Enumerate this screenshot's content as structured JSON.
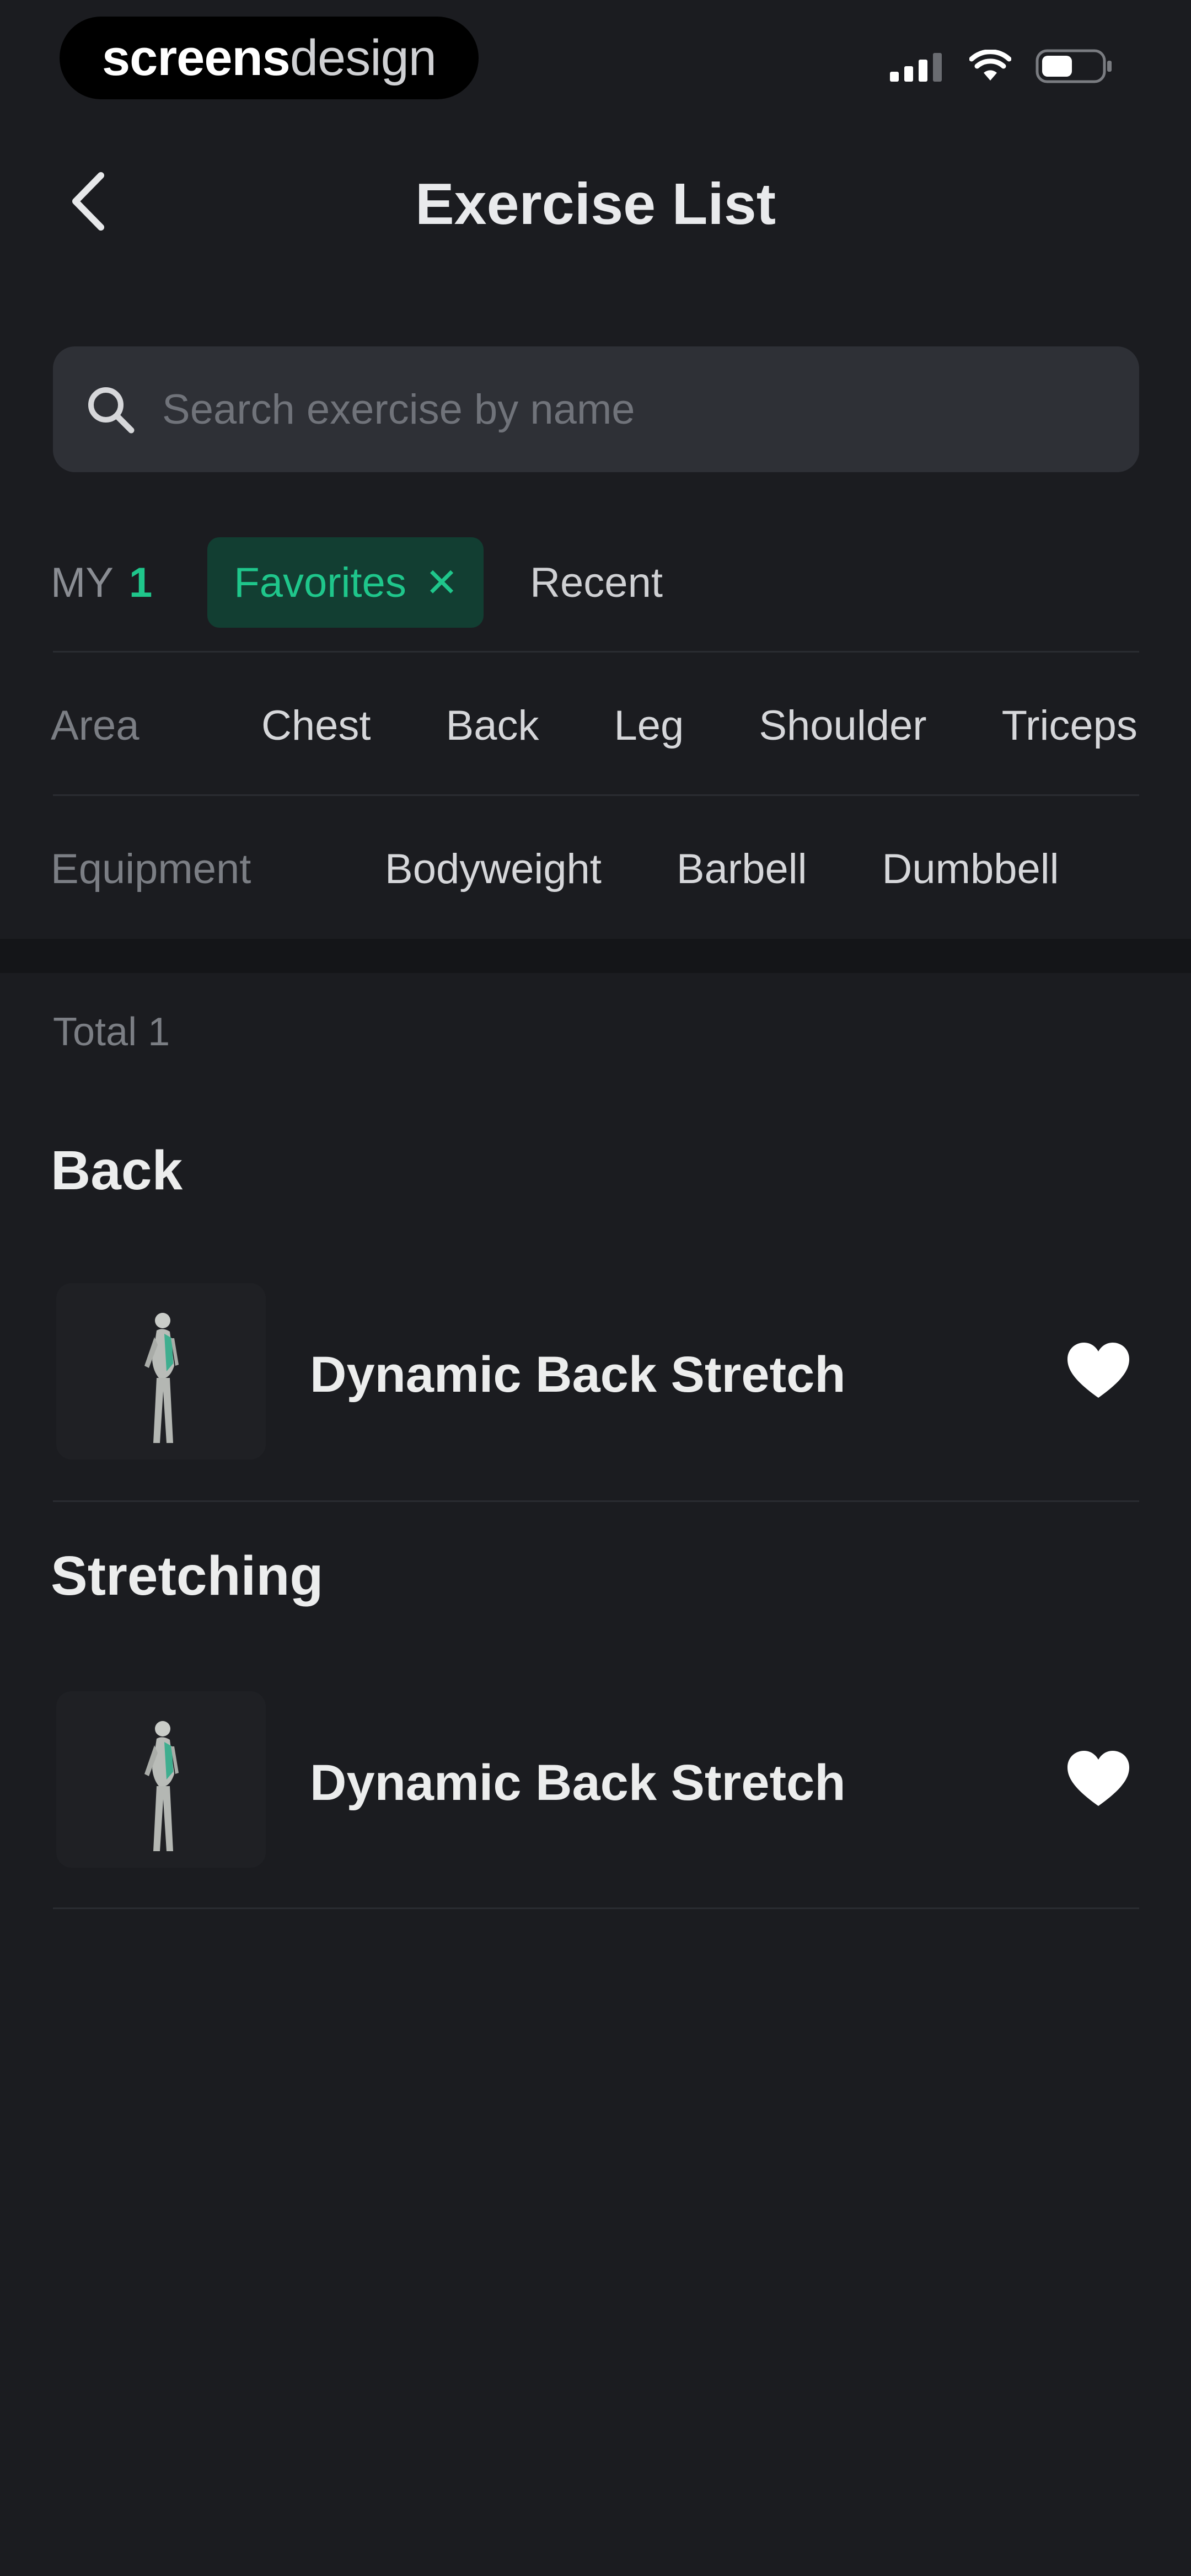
{
  "status_bar": {
    "brand_strong": "screens",
    "brand_light": "design",
    "icons": [
      "signal-icon",
      "wifi-icon",
      "battery-icon"
    ]
  },
  "nav": {
    "title": "Exercise List",
    "back_icon": "chevron-left-icon"
  },
  "search": {
    "placeholder": "Search exercise by name",
    "value": "",
    "icon": "search-icon"
  },
  "filters": {
    "my_label": "MY",
    "my_count": "1",
    "favorites_label": "Favorites",
    "favorites_close": "✕",
    "recent_label": "Recent",
    "area_label": "Area",
    "area_options": [
      "Chest",
      "Back",
      "Leg",
      "Shoulder",
      "Triceps"
    ],
    "equipment_label": "Equipment",
    "equipment_options": [
      "Bodyweight",
      "Barbell",
      "Dumbbell"
    ]
  },
  "list": {
    "total_label": "Total 1",
    "groups": [
      {
        "title": "Back",
        "items": [
          {
            "name": "Dynamic Back Stretch",
            "favorite": true
          }
        ]
      },
      {
        "title": "Stretching",
        "items": [
          {
            "name": "Dynamic Back Stretch",
            "favorite": true
          }
        ]
      }
    ]
  },
  "colors": {
    "background": "#1b1c20",
    "accent": "#1fc68b",
    "chip_background": "#123e32",
    "search_background": "#2e3036"
  }
}
